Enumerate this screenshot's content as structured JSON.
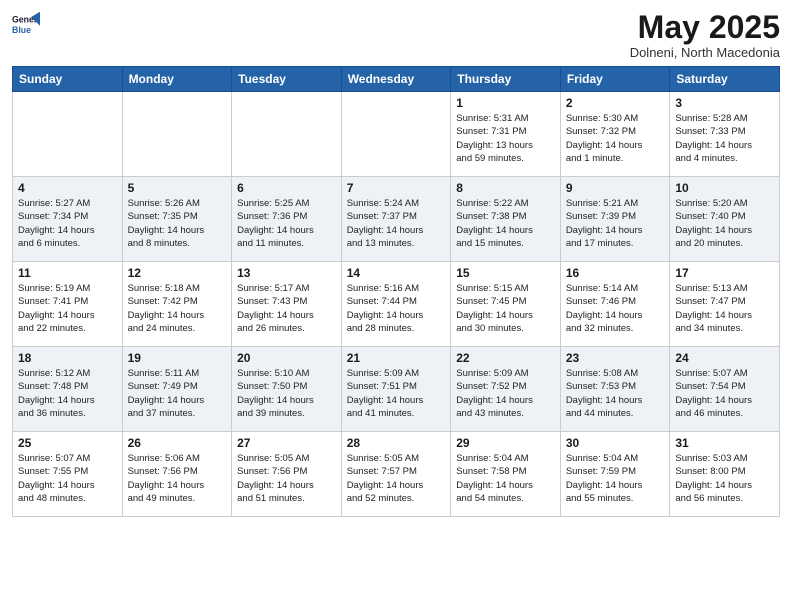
{
  "header": {
    "logo_line1": "General",
    "logo_line2": "Blue",
    "month": "May 2025",
    "location": "Dolneni, North Macedonia"
  },
  "weekdays": [
    "Sunday",
    "Monday",
    "Tuesday",
    "Wednesday",
    "Thursday",
    "Friday",
    "Saturday"
  ],
  "weeks": [
    [
      {
        "day": "",
        "info": ""
      },
      {
        "day": "",
        "info": ""
      },
      {
        "day": "",
        "info": ""
      },
      {
        "day": "",
        "info": ""
      },
      {
        "day": "1",
        "info": "Sunrise: 5:31 AM\nSunset: 7:31 PM\nDaylight: 13 hours\nand 59 minutes."
      },
      {
        "day": "2",
        "info": "Sunrise: 5:30 AM\nSunset: 7:32 PM\nDaylight: 14 hours\nand 1 minute."
      },
      {
        "day": "3",
        "info": "Sunrise: 5:28 AM\nSunset: 7:33 PM\nDaylight: 14 hours\nand 4 minutes."
      }
    ],
    [
      {
        "day": "4",
        "info": "Sunrise: 5:27 AM\nSunset: 7:34 PM\nDaylight: 14 hours\nand 6 minutes."
      },
      {
        "day": "5",
        "info": "Sunrise: 5:26 AM\nSunset: 7:35 PM\nDaylight: 14 hours\nand 8 minutes."
      },
      {
        "day": "6",
        "info": "Sunrise: 5:25 AM\nSunset: 7:36 PM\nDaylight: 14 hours\nand 11 minutes."
      },
      {
        "day": "7",
        "info": "Sunrise: 5:24 AM\nSunset: 7:37 PM\nDaylight: 14 hours\nand 13 minutes."
      },
      {
        "day": "8",
        "info": "Sunrise: 5:22 AM\nSunset: 7:38 PM\nDaylight: 14 hours\nand 15 minutes."
      },
      {
        "day": "9",
        "info": "Sunrise: 5:21 AM\nSunset: 7:39 PM\nDaylight: 14 hours\nand 17 minutes."
      },
      {
        "day": "10",
        "info": "Sunrise: 5:20 AM\nSunset: 7:40 PM\nDaylight: 14 hours\nand 20 minutes."
      }
    ],
    [
      {
        "day": "11",
        "info": "Sunrise: 5:19 AM\nSunset: 7:41 PM\nDaylight: 14 hours\nand 22 minutes."
      },
      {
        "day": "12",
        "info": "Sunrise: 5:18 AM\nSunset: 7:42 PM\nDaylight: 14 hours\nand 24 minutes."
      },
      {
        "day": "13",
        "info": "Sunrise: 5:17 AM\nSunset: 7:43 PM\nDaylight: 14 hours\nand 26 minutes."
      },
      {
        "day": "14",
        "info": "Sunrise: 5:16 AM\nSunset: 7:44 PM\nDaylight: 14 hours\nand 28 minutes."
      },
      {
        "day": "15",
        "info": "Sunrise: 5:15 AM\nSunset: 7:45 PM\nDaylight: 14 hours\nand 30 minutes."
      },
      {
        "day": "16",
        "info": "Sunrise: 5:14 AM\nSunset: 7:46 PM\nDaylight: 14 hours\nand 32 minutes."
      },
      {
        "day": "17",
        "info": "Sunrise: 5:13 AM\nSunset: 7:47 PM\nDaylight: 14 hours\nand 34 minutes."
      }
    ],
    [
      {
        "day": "18",
        "info": "Sunrise: 5:12 AM\nSunset: 7:48 PM\nDaylight: 14 hours\nand 36 minutes."
      },
      {
        "day": "19",
        "info": "Sunrise: 5:11 AM\nSunset: 7:49 PM\nDaylight: 14 hours\nand 37 minutes."
      },
      {
        "day": "20",
        "info": "Sunrise: 5:10 AM\nSunset: 7:50 PM\nDaylight: 14 hours\nand 39 minutes."
      },
      {
        "day": "21",
        "info": "Sunrise: 5:09 AM\nSunset: 7:51 PM\nDaylight: 14 hours\nand 41 minutes."
      },
      {
        "day": "22",
        "info": "Sunrise: 5:09 AM\nSunset: 7:52 PM\nDaylight: 14 hours\nand 43 minutes."
      },
      {
        "day": "23",
        "info": "Sunrise: 5:08 AM\nSunset: 7:53 PM\nDaylight: 14 hours\nand 44 minutes."
      },
      {
        "day": "24",
        "info": "Sunrise: 5:07 AM\nSunset: 7:54 PM\nDaylight: 14 hours\nand 46 minutes."
      }
    ],
    [
      {
        "day": "25",
        "info": "Sunrise: 5:07 AM\nSunset: 7:55 PM\nDaylight: 14 hours\nand 48 minutes."
      },
      {
        "day": "26",
        "info": "Sunrise: 5:06 AM\nSunset: 7:56 PM\nDaylight: 14 hours\nand 49 minutes."
      },
      {
        "day": "27",
        "info": "Sunrise: 5:05 AM\nSunset: 7:56 PM\nDaylight: 14 hours\nand 51 minutes."
      },
      {
        "day": "28",
        "info": "Sunrise: 5:05 AM\nSunset: 7:57 PM\nDaylight: 14 hours\nand 52 minutes."
      },
      {
        "day": "29",
        "info": "Sunrise: 5:04 AM\nSunset: 7:58 PM\nDaylight: 14 hours\nand 54 minutes."
      },
      {
        "day": "30",
        "info": "Sunrise: 5:04 AM\nSunset: 7:59 PM\nDaylight: 14 hours\nand 55 minutes."
      },
      {
        "day": "31",
        "info": "Sunrise: 5:03 AM\nSunset: 8:00 PM\nDaylight: 14 hours\nand 56 minutes."
      }
    ]
  ]
}
